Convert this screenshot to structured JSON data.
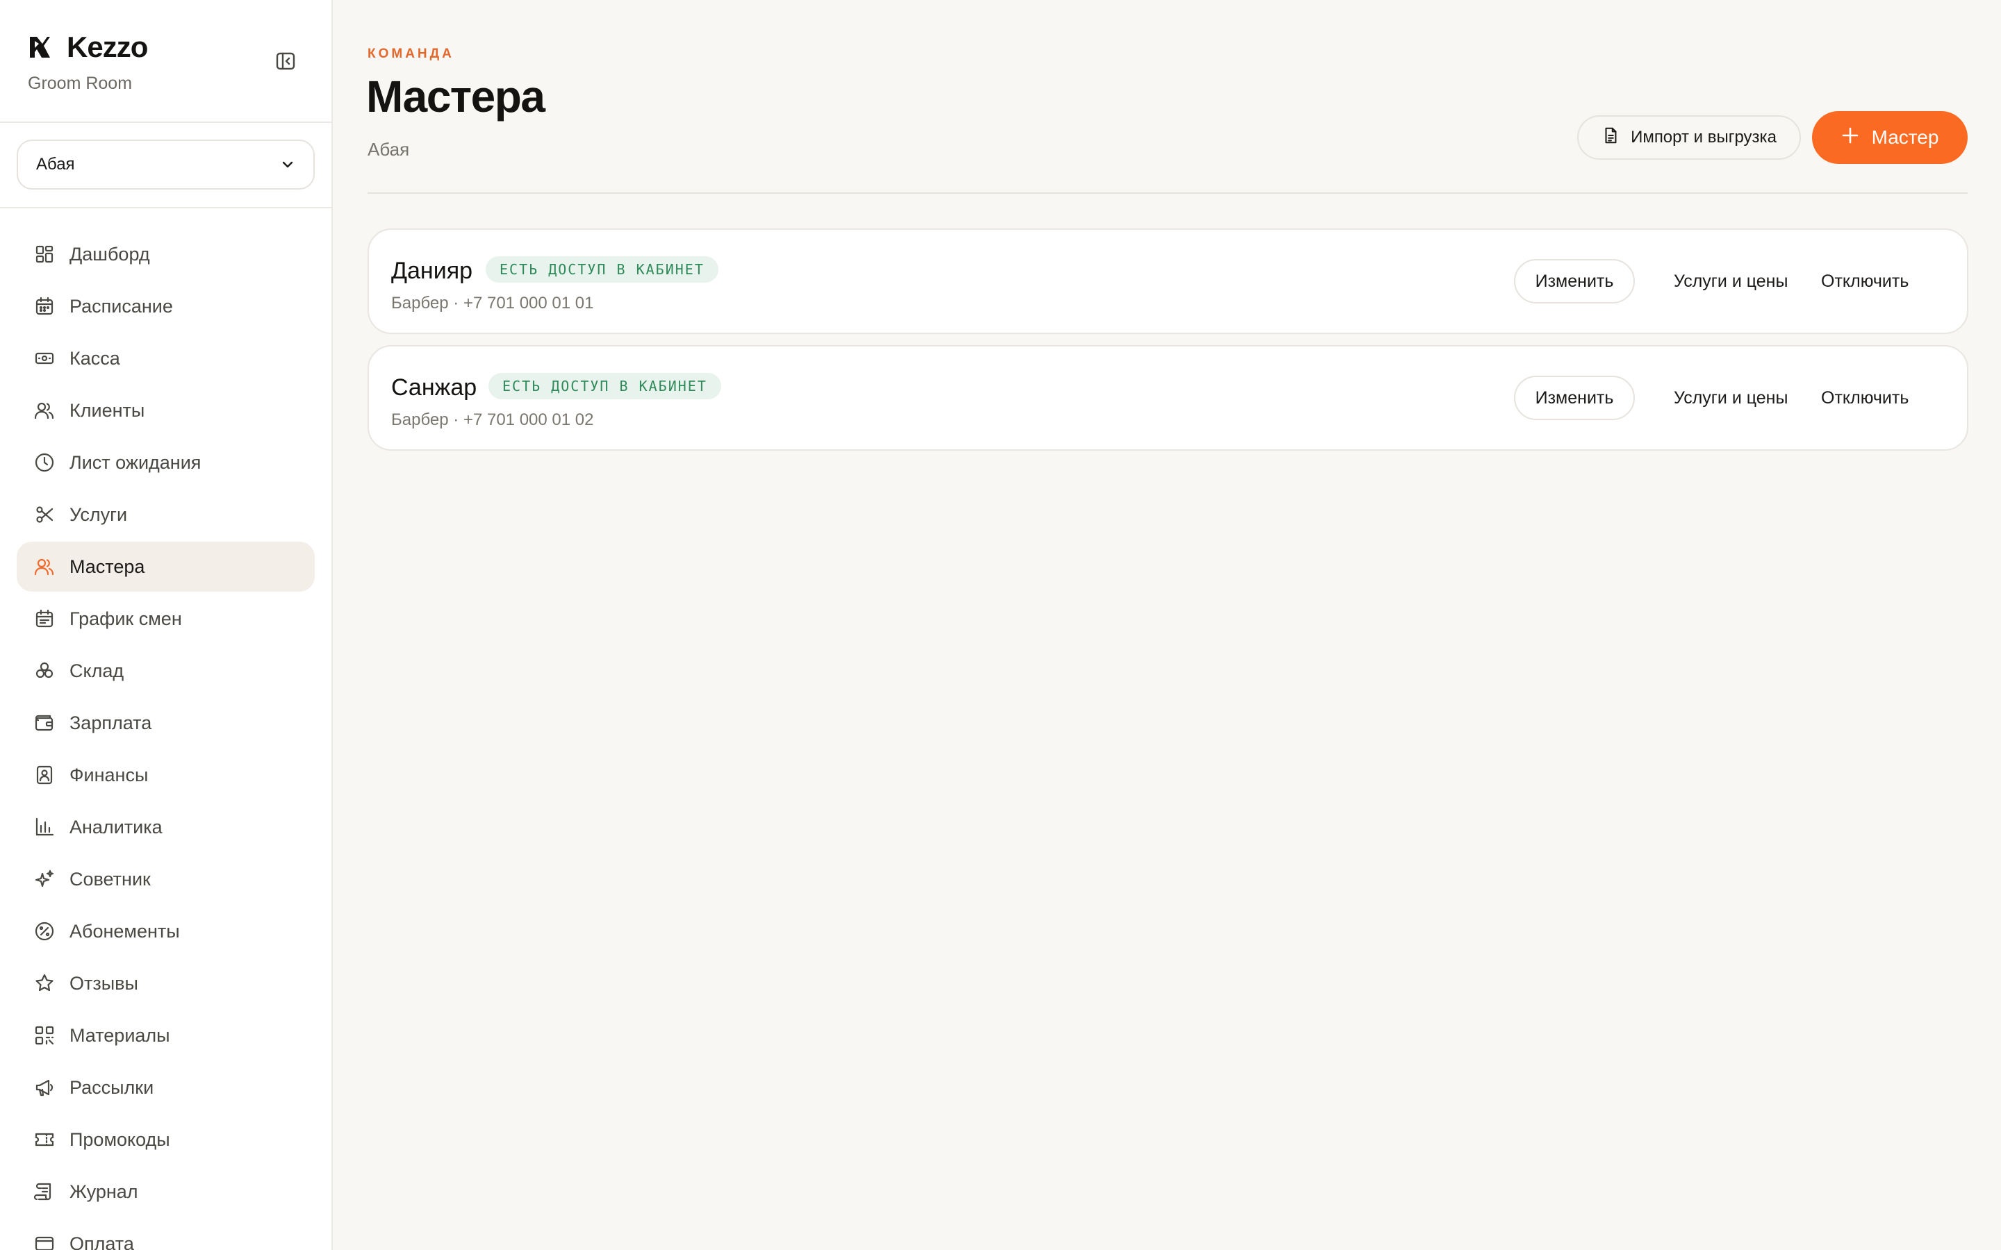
{
  "brand": {
    "name": "Kezzo",
    "subtitle": "Groom Room"
  },
  "branch_select": {
    "value": "Абая"
  },
  "nav": [
    {
      "label": "Дашборд",
      "icon": "dashboard-icon",
      "active": false
    },
    {
      "label": "Расписание",
      "icon": "calendar-icon",
      "active": false
    },
    {
      "label": "Касса",
      "icon": "cash-icon",
      "active": false
    },
    {
      "label": "Клиенты",
      "icon": "users-icon",
      "active": false
    },
    {
      "label": "Лист ожидания",
      "icon": "clock-icon",
      "active": false
    },
    {
      "label": "Услуги",
      "icon": "scissors-icon",
      "active": false
    },
    {
      "label": "Мастера",
      "icon": "masters-icon",
      "active": true
    },
    {
      "label": "График смен",
      "icon": "schedule-icon",
      "active": false
    },
    {
      "label": "Склад",
      "icon": "warehouse-icon",
      "active": false
    },
    {
      "label": "Зарплата",
      "icon": "wallet-icon",
      "active": false
    },
    {
      "label": "Финансы",
      "icon": "finance-icon",
      "active": false
    },
    {
      "label": "Аналитика",
      "icon": "chart-icon",
      "active": false
    },
    {
      "label": "Советник",
      "icon": "sparkles-icon",
      "active": false
    },
    {
      "label": "Абонементы",
      "icon": "percent-badge-icon",
      "active": false
    },
    {
      "label": "Отзывы",
      "icon": "star-icon",
      "active": false
    },
    {
      "label": "Материалы",
      "icon": "qr-icon",
      "active": false
    },
    {
      "label": "Рассылки",
      "icon": "megaphone-icon",
      "active": false
    },
    {
      "label": "Промокоды",
      "icon": "ticket-icon",
      "active": false
    },
    {
      "label": "Журнал",
      "icon": "scroll-icon",
      "active": false
    },
    {
      "label": "Оплата",
      "icon": "card-icon",
      "active": false
    }
  ],
  "header": {
    "eyebrow": "КОМАНДА",
    "title": "Мастера",
    "subtitle": "Абая",
    "import_label": "Импорт и выгрузка",
    "add_label": "Мастер"
  },
  "masters": [
    {
      "name": "Данияр",
      "badge": "ЕСТЬ ДОСТУП В КАБИНЕТ",
      "meta": "Барбер · +7 701 000 01 01",
      "edit": "Изменить",
      "services": "Услуги и цены",
      "disable": "Отключить"
    },
    {
      "name": "Санжар",
      "badge": "ЕСТЬ ДОСТУП В КАБИНЕТ",
      "meta": "Барбер · +7 701 000 01 02",
      "edit": "Изменить",
      "services": "Услуги и цены",
      "disable": "Отключить"
    }
  ],
  "colors": {
    "accent": "#fb6a22",
    "eyebrow": "#e2682c",
    "badge_bg": "#e7f3ec",
    "badge_text": "#2f8a5a"
  }
}
